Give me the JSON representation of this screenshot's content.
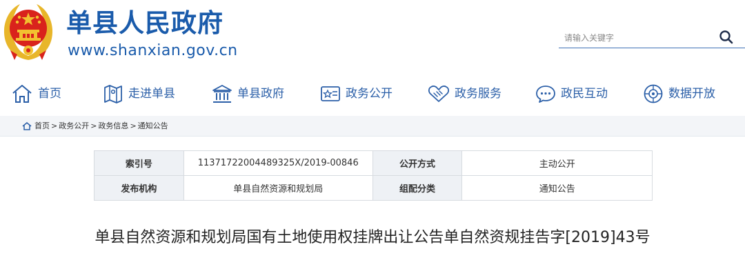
{
  "header": {
    "site_title": "单县人民政府",
    "site_url": "www.shanxian.gov.cn",
    "emblem_icon": "national-emblem-icon"
  },
  "search": {
    "placeholder": "请输入关键字",
    "icon": "search-icon"
  },
  "nav": {
    "items": [
      {
        "label": "首页",
        "icon": "home-icon"
      },
      {
        "label": "走进单县",
        "icon": "map-icon"
      },
      {
        "label": "单县政府",
        "icon": "government-building-icon"
      },
      {
        "label": "政务公开",
        "icon": "open-affairs-icon"
      },
      {
        "label": "政务服务",
        "icon": "handshake-icon"
      },
      {
        "label": "政民互动",
        "icon": "chat-icon"
      },
      {
        "label": "数据开放",
        "icon": "data-open-icon"
      }
    ]
  },
  "breadcrumb": {
    "home": "首页",
    "items": [
      "政务公开",
      "政务信息",
      "通知公告"
    ],
    "separator": ">"
  },
  "info": {
    "rows": [
      {
        "k1": "索引号",
        "v1": "11371722004489325X/2019-00846",
        "k2": "公开方式",
        "v2": "主动公开"
      },
      {
        "k1": "发布机构",
        "v1": "单县自然资源和规划局",
        "k2": "组配分类",
        "v2": "通知公告"
      }
    ]
  },
  "article": {
    "title": "单县自然资源和规划局国有土地使用权挂牌出让公告单自然资规挂告字[2019]43号"
  },
  "colors": {
    "brand_blue": "#1a5bab",
    "nav_blue": "#2b5fa8",
    "emblem_red": "#d9231c",
    "emblem_gold": "#f2c230"
  }
}
